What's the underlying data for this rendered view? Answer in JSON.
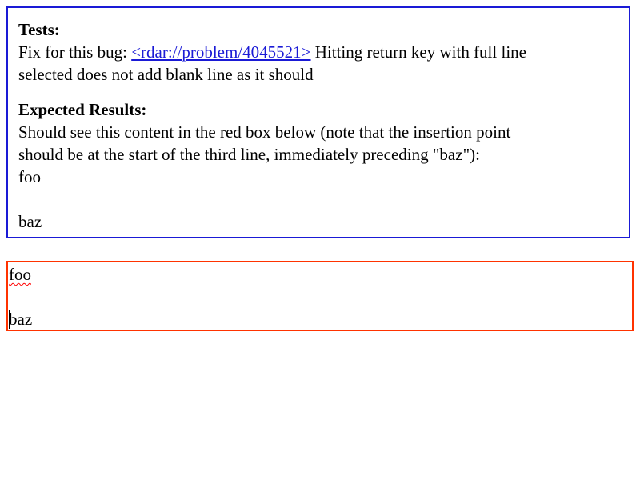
{
  "explanation": {
    "tests_heading": "Tests:",
    "tests_prefix": "Fix for this bug: ",
    "bug_link_text": "<rdar://problem/4045521>",
    "tests_suffix_line1": " Hitting return key with full line",
    "tests_suffix_line2": "selected does not add blank line as it should",
    "expected_heading": "Expected Results:",
    "expected_line1": "Should see this content in the red box below (note that the insertion point",
    "expected_line2": "should be at the start of the third line, immediately preceding \"baz\"):",
    "expected_content": [
      "foo",
      "",
      "baz"
    ]
  },
  "test_box": {
    "lines": [
      "foo",
      "",
      "baz"
    ]
  },
  "colors": {
    "explanation_border": "#1a1ad6",
    "test_box_border": "#ff3300",
    "link": "#1a1ad6",
    "spellcheck_underline": "#ff0000"
  }
}
